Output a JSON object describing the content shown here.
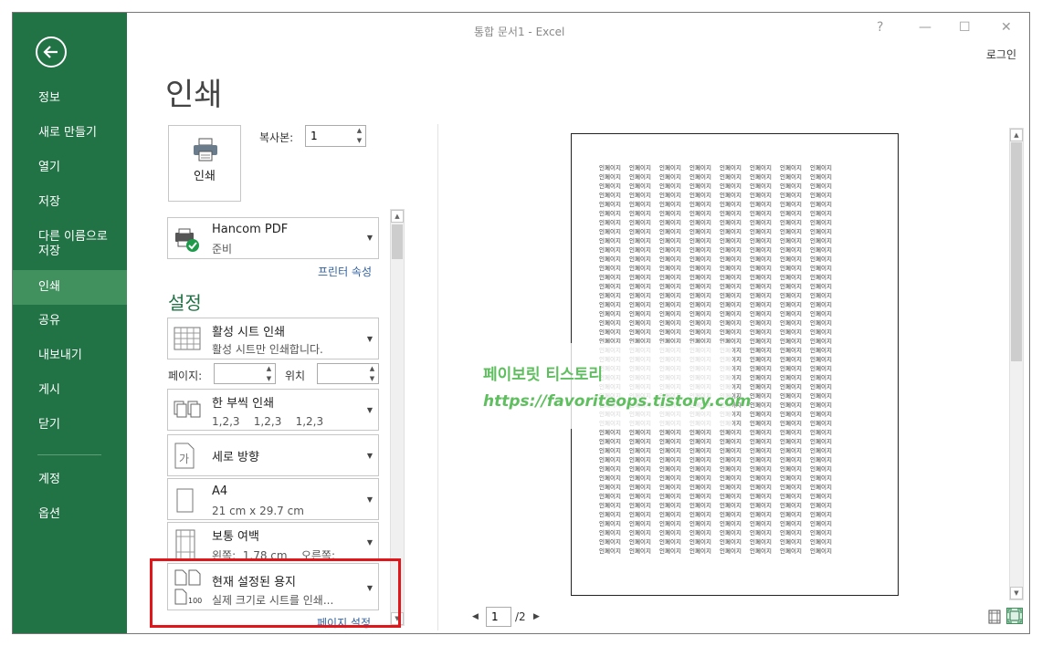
{
  "window": {
    "title": "통합 문서1 - Excel",
    "login_label": "로그인",
    "help": "?",
    "minimize": "—",
    "maximize": "☐",
    "close": "✕"
  },
  "sidebar": {
    "items": [
      {
        "label": "정보"
      },
      {
        "label": "새로 만들기"
      },
      {
        "label": "열기"
      },
      {
        "label": "저장"
      },
      {
        "label": "다른 이름으로 저장"
      },
      {
        "label": "인쇄",
        "active": true
      },
      {
        "label": "공유"
      },
      {
        "label": "내보내기"
      },
      {
        "label": "게시"
      },
      {
        "label": "닫기"
      },
      {
        "label": "계정"
      },
      {
        "label": "옵션"
      }
    ],
    "bg_color": "#217346",
    "active_color": "#41915f"
  },
  "print_panel": {
    "title": "인쇄",
    "print_button_label": "인쇄",
    "copies_label": "복사본:",
    "copies_value": "1",
    "printer": {
      "name": "Hancom PDF",
      "status": "준비",
      "properties_link": "프린터 속성"
    },
    "settings_title": "설정",
    "what": {
      "title": "활성 시트 인쇄",
      "subtitle": "활성 시트만 인쇄합니다."
    },
    "pages_label": "페이지:",
    "to_label": "위치",
    "collate": {
      "title": "한 부씩 인쇄",
      "subtitle": "1,2,3    1,2,3    1,2,3"
    },
    "orientation": {
      "title": "세로 방향"
    },
    "paper": {
      "title": "A4",
      "subtitle": "21 cm x 29.7 cm"
    },
    "margins": {
      "title": "보통 여백",
      "subtitle": "왼쪽:  1.78 cm    오른쪽:"
    },
    "scaling": {
      "title": "현재 설정된 용지",
      "subtitle": "실제 크기로 시트를 인쇄..."
    },
    "page_setup_link": "페이지 설정"
  },
  "preview": {
    "cell_text": "인페이지",
    "current_page": "1",
    "total_pages": "/2",
    "watermark_line1": "페이보릿 티스토리",
    "watermark_line2": "https://favoriteops.tistory.com"
  },
  "highlight_color": "#e0161b"
}
